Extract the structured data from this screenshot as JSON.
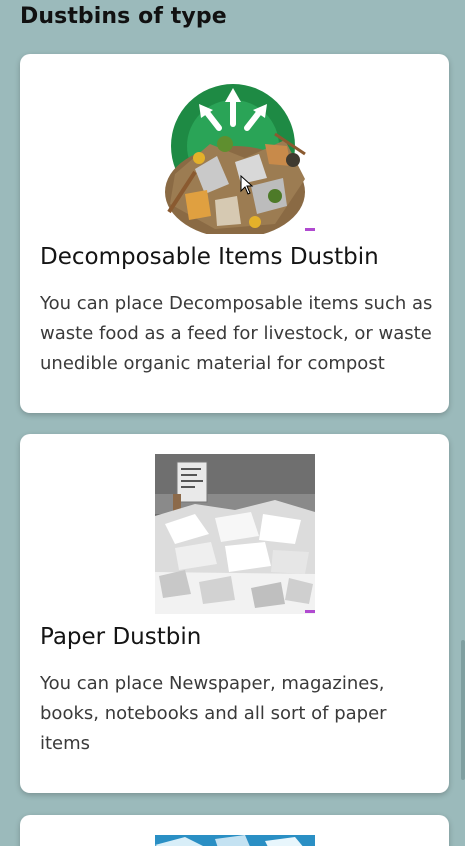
{
  "header": {
    "title": "Dustbins of type"
  },
  "cards": [
    {
      "title": "Decomposable Items Dustbin",
      "description": "You can place Decomposable items such as waste food as a feed for livestock, or waste unedible organic material for compost",
      "image_icon": "compost-image"
    },
    {
      "title": "Paper Dustbin",
      "description": "You can place Newspaper, magazines, books, notebooks and all sort of paper items",
      "image_icon": "paper-waste-image"
    },
    {
      "image_icon": "plastic-waste-image"
    }
  ],
  "colors": {
    "background": "#9bbabb",
    "card": "#ffffff",
    "recycle_green": "#1e8a44"
  }
}
